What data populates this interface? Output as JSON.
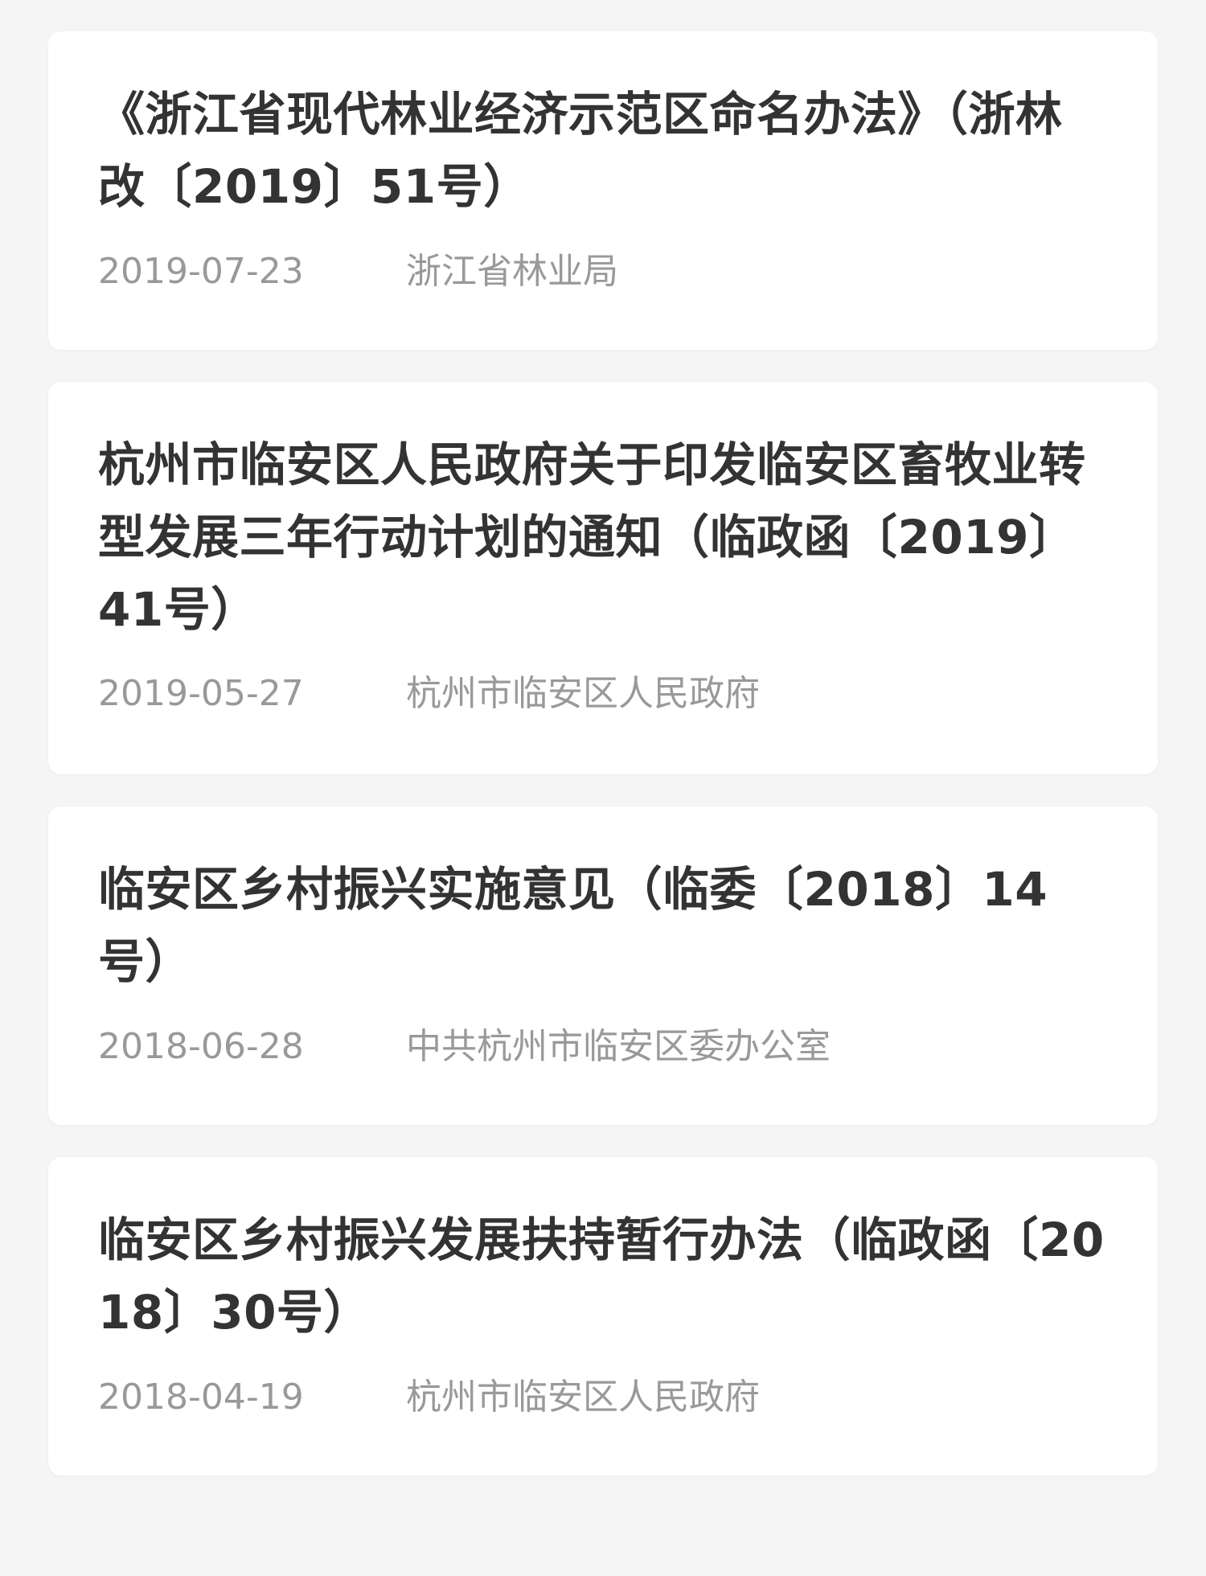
{
  "documents": [
    {
      "title": "《浙江省现代林业经济示范区命名办法》（浙林改〔2019〕51号）",
      "date": "2019-07-23",
      "source": "浙江省林业局"
    },
    {
      "title": "杭州市临安区人民政府关于印发临安区畜牧业转型发展三年行动计划的通知（临政函〔2019〕41号）",
      "date": "2019-05-27",
      "source": "杭州市临安区人民政府"
    },
    {
      "title": "临安区乡村振兴实施意见（临委〔2018〕14号）",
      "date": "2018-06-28",
      "source": "中共杭州市临安区委办公室"
    },
    {
      "title": "临安区乡村振兴发展扶持暂行办法（临政函〔2018〕30号）",
      "date": "2018-04-19",
      "source": "杭州市临安区人民政府"
    }
  ]
}
